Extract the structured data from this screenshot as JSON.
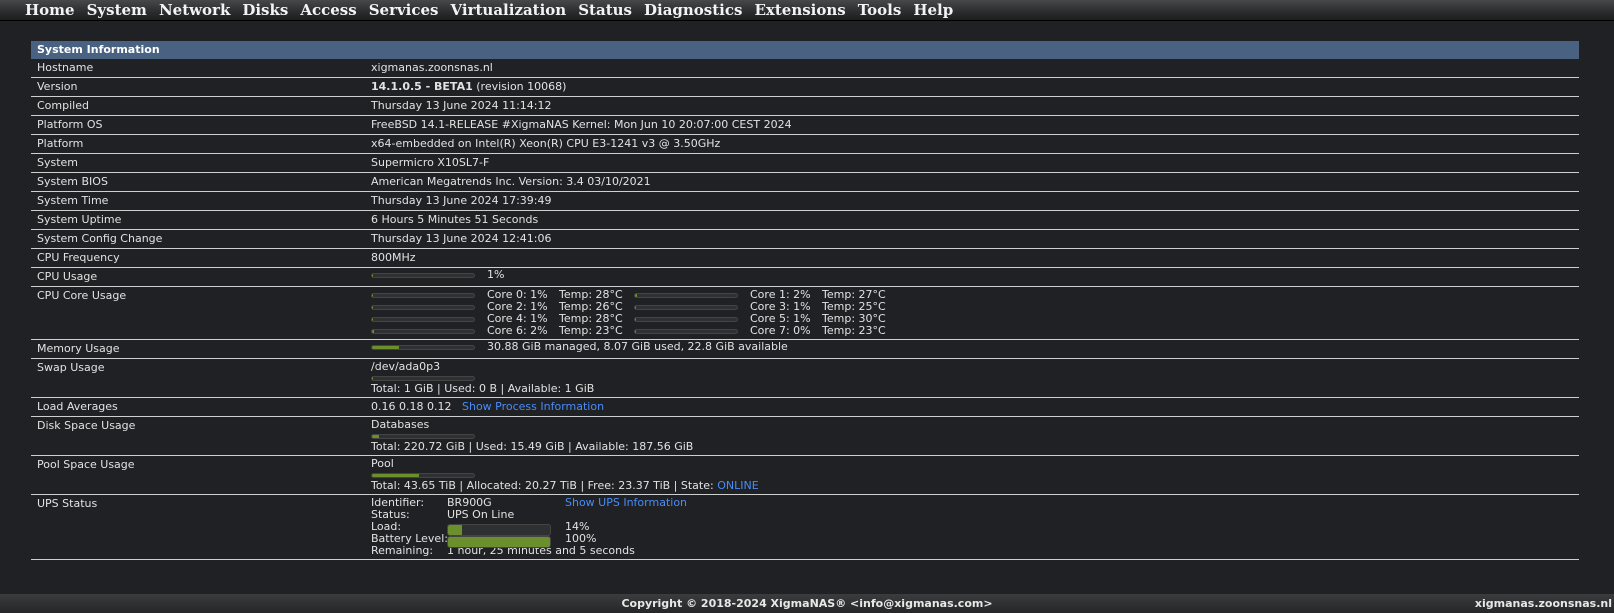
{
  "nav": [
    "Home",
    "System",
    "Network",
    "Disks",
    "Access",
    "Services",
    "Virtualization",
    "Status",
    "Diagnostics",
    "Extensions",
    "Tools",
    "Help"
  ],
  "panel_title": "System Information",
  "rows": {
    "hostname": {
      "label": "Hostname",
      "value": "xigmanas.zoonsnas.nl"
    },
    "version": {
      "label": "Version",
      "value_bold": "14.1.0.5 - BETA1",
      "value_rest": " (revision 10068)"
    },
    "compiled": {
      "label": "Compiled",
      "value": "Thursday 13 June 2024 11:14:12"
    },
    "platform_os": {
      "label": "Platform OS",
      "value": "FreeBSD 14.1-RELEASE #XigmaNAS Kernel: Mon Jun 10 20:07:00 CEST 2024"
    },
    "platform": {
      "label": "Platform",
      "value": "x64-embedded on Intel(R) Xeon(R) CPU E3-1241 v3 @ 3.50GHz"
    },
    "system": {
      "label": "System",
      "value": "Supermicro X10SL7-F"
    },
    "bios": {
      "label": "System BIOS",
      "value": "American Megatrends Inc. Version: 3.4 03/10/2021"
    },
    "time": {
      "label": "System Time",
      "value": "Thursday 13 June 2024 17:39:49"
    },
    "uptime": {
      "label": "System Uptime",
      "value": "6 Hours 5 Minutes 51 Seconds"
    },
    "config_change": {
      "label": "System Config Change",
      "value": "Thursday 13 June 2024 12:41:06"
    },
    "cpu_freq": {
      "label": "CPU Frequency",
      "value": "800MHz"
    },
    "cpu_usage": {
      "label": "CPU Usage",
      "value": "1%",
      "percent": 1
    },
    "core_usage": {
      "label": "CPU Core Usage"
    },
    "memory": {
      "label": "Memory Usage",
      "value": "30.88 GiB managed, 8.07 GiB used, 22.8 GiB available",
      "percent": 26
    },
    "swap": {
      "label": "Swap Usage",
      "device": "/dev/ada0p3",
      "totals": "Total: 1 GiB | Used: 0 B | Available: 1 GiB",
      "percent": 0
    },
    "load": {
      "label": "Load Averages",
      "value": "0.16 0.18 0.12",
      "link": "Show Process Information"
    },
    "disk": {
      "label": "Disk Space Usage",
      "name": "Databases",
      "totals": "Total: 220.72 GiB | Used: 15.49 GiB | Available: 187.56 GiB",
      "percent": 7
    },
    "pool": {
      "label": "Pool Space Usage",
      "name": "Pool",
      "totals_prefix": "Total: 43.65 TiB | Allocated: 20.27 TiB | Free: 23.37 TiB | State: ",
      "state": "ONLINE",
      "percent": 46
    },
    "ups": {
      "label": "UPS Status",
      "link": "Show UPS Information",
      "identifier_label": "Identifier:",
      "identifier": "BR900G",
      "status_label": "Status:",
      "status": "UPS On Line",
      "load_label": "Load:",
      "load": "14%",
      "load_percent": 14,
      "battery_label": "Battery Level:",
      "battery": "100%",
      "battery_percent": 100,
      "remaining_label": "Remaining:",
      "remaining": "1 hour, 25 minutes and 5 seconds"
    }
  },
  "cores": [
    {
      "core": "Core 0: 1%",
      "temp": "Temp: 28°C",
      "percent": 1
    },
    {
      "core": "Core 1: 2%",
      "temp": "Temp: 27°C",
      "percent": 2
    },
    {
      "core": "Core 2: 1%",
      "temp": "Temp: 26°C",
      "percent": 1
    },
    {
      "core": "Core 3: 1%",
      "temp": "Temp: 25°C",
      "percent": 1
    },
    {
      "core": "Core 4: 1%",
      "temp": "Temp: 28°C",
      "percent": 1
    },
    {
      "core": "Core 5: 1%",
      "temp": "Temp: 30°C",
      "percent": 1
    },
    {
      "core": "Core 6: 2%",
      "temp": "Temp: 23°C",
      "percent": 2
    },
    {
      "core": "Core 7: 0%",
      "temp": "Temp: 23°C",
      "percent": 0
    }
  ],
  "footer": {
    "copyright": "Copyright © 2018-2024 XigmaNAS® <info@xigmanas.com>",
    "hostname": "xigmanas.zoonsnas.nl"
  },
  "colors": {
    "header_bar": "#4a6282",
    "bar_fill": "#6a8f2c",
    "link": "#4a8cf7",
    "background": "#1f2124"
  }
}
